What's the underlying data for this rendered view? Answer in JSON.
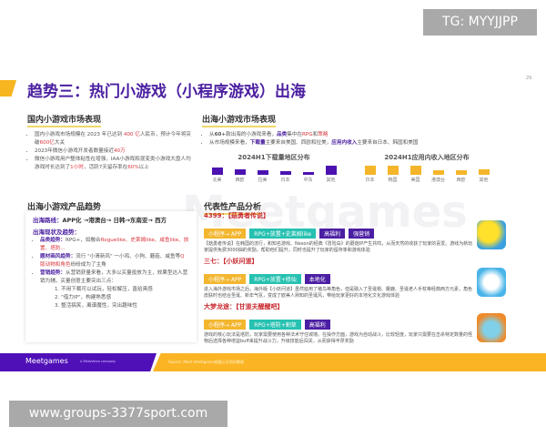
{
  "overlays": {
    "top": "TG: MYYJJPP",
    "bottom": "www.groups-3377sport.com"
  },
  "page_number": "29",
  "watermark": "Meetgames",
  "title": "趋势三：热门小游戏（小程序游戏）出海",
  "domestic": {
    "heading": "国内小游戏市场表现",
    "b1a": "国内小游戏市场规模在 2023 年已达到 ",
    "b1r": "400 亿",
    "b1b": "人民币，预计今年将突破",
    "b1r2": "600亿",
    "b1c": "大关",
    "b2a": "2023年微信小游戏开发者数量接近",
    "b2r": "40万",
    "b3a": "微信小游戏用户整体粘性在增强，IAA小游戏和混变类小游戏大盘人均游戏时长达到了",
    "b3r": "1小时",
    "b3b": "，活跃7天留存率在",
    "b3r2": "60%",
    "b3c": "以上"
  },
  "overseas": {
    "heading": "出海小游戏市场表现",
    "b1a": "从",
    "b1b": "60+",
    "b1c": "款出海的小游戏来看，",
    "b1p": "品类",
    "b1d": "集中在",
    "b1r": "RPG",
    "b1e": "和",
    "b1r2": "策略",
    "b2a": "从市场规模来看，",
    "b2p": "下载量",
    "b2b": "主要来自美国、西欧和拉美，",
    "b2p2": "应用内收入",
    "b2c": "主要来自日本、韩国和美国"
  },
  "chart_data": [
    {
      "type": "bar",
      "title": "2024H1下载量地区分布",
      "categories": [
        "北美",
        "西欧",
        "拉美",
        "日本",
        "中东",
        "其他"
      ],
      "values": [
        70,
        45,
        40,
        25,
        15,
        100
      ],
      "color": "#4b12b0"
    },
    {
      "type": "bar",
      "title": "2024H1应用内收入地区分布",
      "categories": [
        "日本",
        "韩国",
        "美国",
        "港澳台",
        "西欧",
        "其他"
      ],
      "values": [
        100,
        100,
        95,
        35,
        35,
        55
      ],
      "color": "#f5b52a"
    }
  ],
  "trends": {
    "heading": "出海小游戏产品趋势",
    "route_label": "出海路线：",
    "route": "APP化 →港澳台→ 日韩→东南亚→ 西方",
    "status": "出海现状及趋势：",
    "c1l": "品类趋势：",
    "c1a": "RPG+，如融合",
    "c1r": "Roguelike、史莱姆like、咸鱼like、放置、塔防...",
    "c2l": "题材画风趋势：",
    "c2a": "流行 \"小清新风\" 一小鸡、小狗、蘑菇、咸鱼等",
    "c2r": "Q版动物和角色",
    "c2b": "纷纷成为了主角",
    "c3l": "营销趋势：",
    "c3a": "从营销获量来看，大多以买量投放为主，效果型达人营销为辅，买量创意主要突出三点：",
    "points": [
      "1. 不用下载可以试玩，轻松解压，直给爽感",
      "2. \"借力IP\"，构建熟悉感",
      "3. 整活搞笑，离谱魔性，突出趣味性"
    ]
  },
  "products": {
    "heading": "代表性产品分析",
    "items": [
      {
        "company": "4399：【菇勇者传说】",
        "tags": [
          "小程序→ APP",
          "RPG+放置+史莱姆like",
          "高福利",
          "强营销"
        ],
        "desc": "【菇勇者传说】在韩国的流行，和知名游戏、Nexon的经典《冒险岛》的蘑菇IP产生共鸣，从而天然的收获了玩家的喜爱。游戏为新玩家提供免费3000抽的奖励，帮助他们提升，同时也提升了玩家的留存率和游戏体验"
      },
      {
        "company": "三七：【小妖问道】",
        "tags": [
          "小程序→ APP",
          "RPG+放置+修仙",
          "本地化"
        ],
        "desc": "进入海外游戏市场之后，海外版【小妖问道】虽然延用了猪鸟等角色，但是融入了圣诞帽、麋鹿、圣诞老人手杖等经典西方元素，角色皮肤时也结合圣诞、新年气氛，变成了欧美人熟知的圣诞风，带给玩家更好的本地化文化游戏体验"
      },
      {
        "company": "大梦龙途：【甘道夫醒醒吧】",
        "tags": [
          "小程序→ APP",
          "RPG+塔防+割草",
          "高福利"
        ],
        "desc": "游戏的核心玩法是塔防，玩家需要使用各种法术守住城墙。在操作方面，游戏为自动战斗，比较轻度，玩家只需要在击杀特定数量的怪物后选择各种增益buff来提升战斗力，升级技能后闯关，从而获得丰厚奖励"
      }
    ]
  },
  "footer": {
    "brand": "Meetgames",
    "tagline": "A MetaVerse company",
    "source": "Source: Meet Intelligence根据公开资料整理"
  },
  "colors": {
    "purple": "#4b12b0",
    "yellow": "#fbb424",
    "teal": "#27c1b1",
    "red": "#d9363e"
  }
}
